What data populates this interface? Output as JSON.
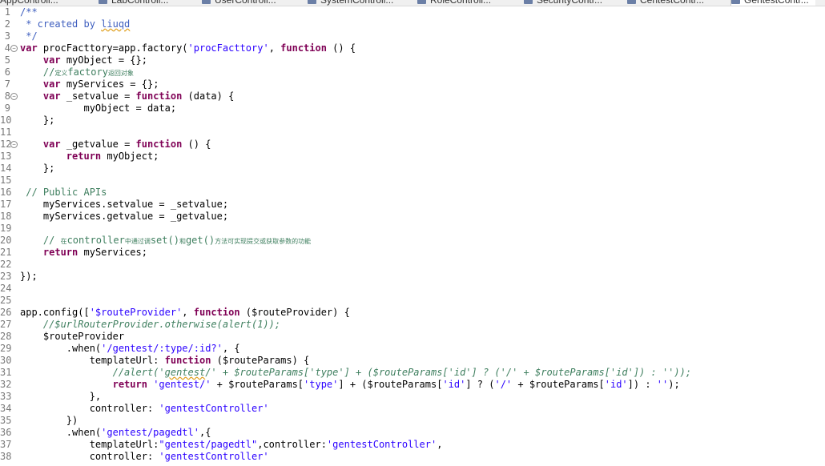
{
  "tabs": [
    {
      "label": "AppControll..."
    },
    {
      "label": "LabControll..."
    },
    {
      "label": "UserControll..."
    },
    {
      "label": "SystemControll..."
    },
    {
      "label": "RoleControll..."
    },
    {
      "label": "SecurityContr..."
    },
    {
      "label": "CentestContr..."
    },
    {
      "label": "GentestContr..."
    }
  ],
  "lines": [
    {
      "n": "1",
      "fold": false,
      "tokens": [
        {
          "t": "/**",
          "c": "doc"
        }
      ]
    },
    {
      "n": "2",
      "fold": false,
      "tokens": [
        {
          "t": " * created by ",
          "c": "doc"
        },
        {
          "t": "liuqd",
          "c": "doc sq"
        }
      ]
    },
    {
      "n": "3",
      "fold": false,
      "tokens": [
        {
          "t": " */",
          "c": "doc"
        }
      ]
    },
    {
      "n": "4",
      "fold": true,
      "tokens": [
        {
          "t": "var",
          "c": "kw"
        },
        {
          "t": " procFacttory=app.factory(",
          "c": ""
        },
        {
          "t": "'procFacttory'",
          "c": "str"
        },
        {
          "t": ", ",
          "c": ""
        },
        {
          "t": "function",
          "c": "kw"
        },
        {
          "t": " () {",
          "c": ""
        }
      ]
    },
    {
      "n": "5",
      "fold": false,
      "tokens": [
        {
          "t": "    ",
          "c": ""
        },
        {
          "t": "var",
          "c": "kw"
        },
        {
          "t": " myObject = {};",
          "c": ""
        }
      ]
    },
    {
      "n": "6",
      "fold": false,
      "tokens": [
        {
          "t": "    //",
          "c": "cm"
        },
        {
          "t": "定义",
          "c": "cm cjk"
        },
        {
          "t": "factory",
          "c": "cm"
        },
        {
          "t": "返回对象",
          "c": "cm cjk"
        }
      ]
    },
    {
      "n": "7",
      "fold": false,
      "tokens": [
        {
          "t": "    ",
          "c": ""
        },
        {
          "t": "var",
          "c": "kw"
        },
        {
          "t": " myServices = {};",
          "c": ""
        }
      ]
    },
    {
      "n": "8",
      "fold": true,
      "tokens": [
        {
          "t": "    ",
          "c": ""
        },
        {
          "t": "var",
          "c": "kw"
        },
        {
          "t": " _setvalue = ",
          "c": ""
        },
        {
          "t": "function",
          "c": "kw"
        },
        {
          "t": " (data) {",
          "c": ""
        }
      ]
    },
    {
      "n": "9",
      "fold": false,
      "tokens": [
        {
          "t": "           myObject = data;",
          "c": ""
        }
      ]
    },
    {
      "n": "10",
      "fold": false,
      "tokens": [
        {
          "t": "    };",
          "c": ""
        }
      ]
    },
    {
      "n": "11",
      "fold": false,
      "tokens": []
    },
    {
      "n": "12",
      "fold": true,
      "tokens": [
        {
          "t": "    ",
          "c": ""
        },
        {
          "t": "var",
          "c": "kw"
        },
        {
          "t": " _getvalue = ",
          "c": ""
        },
        {
          "t": "function",
          "c": "kw"
        },
        {
          "t": " () {",
          "c": ""
        }
      ]
    },
    {
      "n": "13",
      "fold": false,
      "tokens": [
        {
          "t": "        ",
          "c": ""
        },
        {
          "t": "return",
          "c": "kw"
        },
        {
          "t": " myObject;",
          "c": ""
        }
      ]
    },
    {
      "n": "14",
      "fold": false,
      "tokens": [
        {
          "t": "    };",
          "c": ""
        }
      ]
    },
    {
      "n": "15",
      "fold": false,
      "tokens": []
    },
    {
      "n": "16",
      "fold": false,
      "tokens": [
        {
          "t": " // Public APIs",
          "c": "cm"
        }
      ]
    },
    {
      "n": "17",
      "fold": false,
      "tokens": [
        {
          "t": "    myServices.setvalue = _setvalue;",
          "c": ""
        }
      ]
    },
    {
      "n": "18",
      "fold": false,
      "tokens": [
        {
          "t": "    myServices.getvalue = _getvalue;",
          "c": ""
        }
      ]
    },
    {
      "n": "19",
      "fold": false,
      "tokens": []
    },
    {
      "n": "20",
      "fold": false,
      "tokens": [
        {
          "t": "    // ",
          "c": "cm"
        },
        {
          "t": "在",
          "c": "cm cjk"
        },
        {
          "t": "controller",
          "c": "cm"
        },
        {
          "t": "中通过调",
          "c": "cm cjk"
        },
        {
          "t": "set()",
          "c": "cm"
        },
        {
          "t": "和",
          "c": "cm cjk"
        },
        {
          "t": "get()",
          "c": "cm"
        },
        {
          "t": "方法可实现提交或获取参数的功能",
          "c": "cm cjk"
        }
      ]
    },
    {
      "n": "21",
      "fold": false,
      "tokens": [
        {
          "t": "    ",
          "c": ""
        },
        {
          "t": "return",
          "c": "kw"
        },
        {
          "t": " myServices;",
          "c": ""
        }
      ]
    },
    {
      "n": "22",
      "fold": false,
      "tokens": []
    },
    {
      "n": "23",
      "fold": false,
      "tokens": [
        {
          "t": "});",
          "c": ""
        }
      ]
    },
    {
      "n": "24",
      "fold": false,
      "tokens": []
    },
    {
      "n": "25",
      "fold": false,
      "tokens": []
    },
    {
      "n": "26",
      "fold": false,
      "tokens": [
        {
          "t": "app.config([",
          "c": ""
        },
        {
          "t": "'$routeProvider'",
          "c": "str"
        },
        {
          "t": ", ",
          "c": ""
        },
        {
          "t": "function",
          "c": "kw"
        },
        {
          "t": " ($routeProvider) {",
          "c": ""
        }
      ]
    },
    {
      "n": "27",
      "fold": false,
      "tokens": [
        {
          "t": "    //$urlRouterProvider.otherwise(alert(1));",
          "c": "cmi"
        }
      ]
    },
    {
      "n": "28",
      "fold": false,
      "tokens": [
        {
          "t": "    $routeProvider",
          "c": ""
        }
      ]
    },
    {
      "n": "29",
      "fold": false,
      "tokens": [
        {
          "t": "        .when(",
          "c": ""
        },
        {
          "t": "'/gentest/:type/:id?'",
          "c": "str"
        },
        {
          "t": ", {",
          "c": ""
        }
      ]
    },
    {
      "n": "30",
      "fold": false,
      "tokens": [
        {
          "t": "            templateUrl: ",
          "c": ""
        },
        {
          "t": "function",
          "c": "kw"
        },
        {
          "t": " ($routeParams) {",
          "c": ""
        }
      ]
    },
    {
      "n": "31",
      "fold": false,
      "tokens": [
        {
          "t": "                //alert('",
          "c": "cmi"
        },
        {
          "t": "gentest",
          "c": "cmi sq"
        },
        {
          "t": "/' + $routeParams['type'] + ($routeParams['id'] ? ('/' + $routeParams['id']) : ''));",
          "c": "cmi"
        }
      ]
    },
    {
      "n": "32",
      "fold": false,
      "tokens": [
        {
          "t": "                ",
          "c": ""
        },
        {
          "t": "return",
          "c": "kw"
        },
        {
          "t": " ",
          "c": ""
        },
        {
          "t": "'gentest/'",
          "c": "str"
        },
        {
          "t": " + $routeParams[",
          "c": ""
        },
        {
          "t": "'type'",
          "c": "str"
        },
        {
          "t": "] + ($routeParams[",
          "c": ""
        },
        {
          "t": "'id'",
          "c": "str"
        },
        {
          "t": "] ? (",
          "c": ""
        },
        {
          "t": "'/'",
          "c": "str"
        },
        {
          "t": " + $routeParams[",
          "c": ""
        },
        {
          "t": "'id'",
          "c": "str"
        },
        {
          "t": "]) : ",
          "c": ""
        },
        {
          "t": "''",
          "c": "str"
        },
        {
          "t": ");",
          "c": ""
        }
      ]
    },
    {
      "n": "33",
      "fold": false,
      "tokens": [
        {
          "t": "            },",
          "c": ""
        }
      ]
    },
    {
      "n": "34",
      "fold": false,
      "tokens": [
        {
          "t": "            controller: ",
          "c": ""
        },
        {
          "t": "'gentestController'",
          "c": "str"
        }
      ]
    },
    {
      "n": "35",
      "fold": false,
      "tokens": [
        {
          "t": "        })",
          "c": ""
        }
      ]
    },
    {
      "n": "36",
      "fold": false,
      "tokens": [
        {
          "t": "        .when(",
          "c": ""
        },
        {
          "t": "'gentest/pagedtl'",
          "c": "str"
        },
        {
          "t": ",{",
          "c": ""
        }
      ]
    },
    {
      "n": "37",
      "fold": false,
      "tokens": [
        {
          "t": "            templateUrl:",
          "c": ""
        },
        {
          "t": "\"gentest/pagedtl\"",
          "c": "str"
        },
        {
          "t": ",controller:",
          "c": ""
        },
        {
          "t": "'gentestController'",
          "c": "str"
        },
        {
          "t": ",",
          "c": ""
        }
      ]
    },
    {
      "n": "38",
      "fold": false,
      "tokens": [
        {
          "t": "            controller: ",
          "c": ""
        },
        {
          "t": "'gentestController'",
          "c": "str"
        }
      ]
    }
  ]
}
